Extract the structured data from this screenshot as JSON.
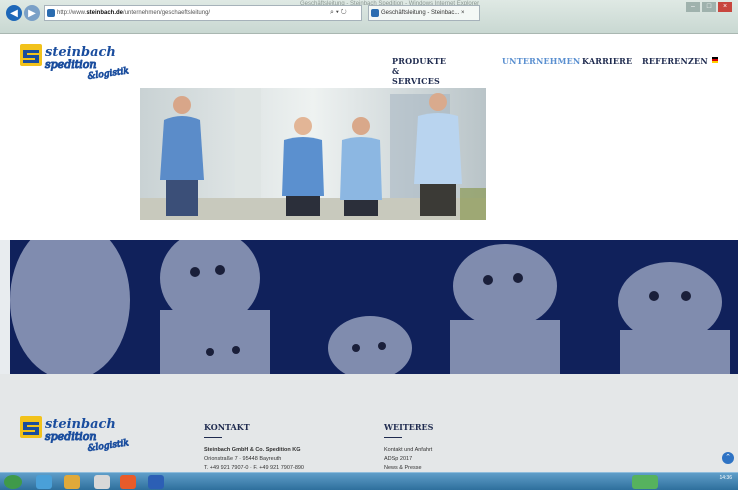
{
  "browser": {
    "url_prefix": "http://www.",
    "url_domain": "steinbach.de",
    "url_path": "/unternehmen/geschaeftsleitung/",
    "address_actions": "⌕ ▾ ↻",
    "tab_title": "Geschäftsleitung - Steinbac... ×",
    "window_title": "Geschäftsleitung - Steinbach Spedition - Windows Internet Explorer",
    "win_min": "–",
    "win_max": "□",
    "win_close": "×",
    "back_glyph": "◀",
    "fwd_glyph": "▶"
  },
  "logo": {
    "line1": "steinbach",
    "line2": "spedition",
    "line3": "&logistik",
    "colors": {
      "blue": "#1a4d9e",
      "yellow": "#f2c21b"
    }
  },
  "nav": {
    "products": "PRODUKTE & SERVICES",
    "company": "UNTERNEHMEN",
    "careers": "KARRIERE",
    "references": "REFERENZEN"
  },
  "footer": {
    "contact_heading": "KONTAKT",
    "contact_company": "Steinbach GmbH & Co. Spedition KG",
    "contact_address": "Orionstraße 7 · 95448 Bayreuth",
    "contact_phone": "T. +49 921 7907-0 · F. +49 921 7907-890",
    "more_heading": "WEITERES",
    "more_links": [
      "Kontakt und Anfahrt",
      "ADSp 2017",
      "News & Presse"
    ],
    "scroll_top_glyph": "⌃"
  },
  "taskbar": {
    "clock": "14:36"
  },
  "colors": {
    "navy": "#10215b",
    "nav_active": "#5a8fd0",
    "footer_bg": "#e4e7e8"
  }
}
